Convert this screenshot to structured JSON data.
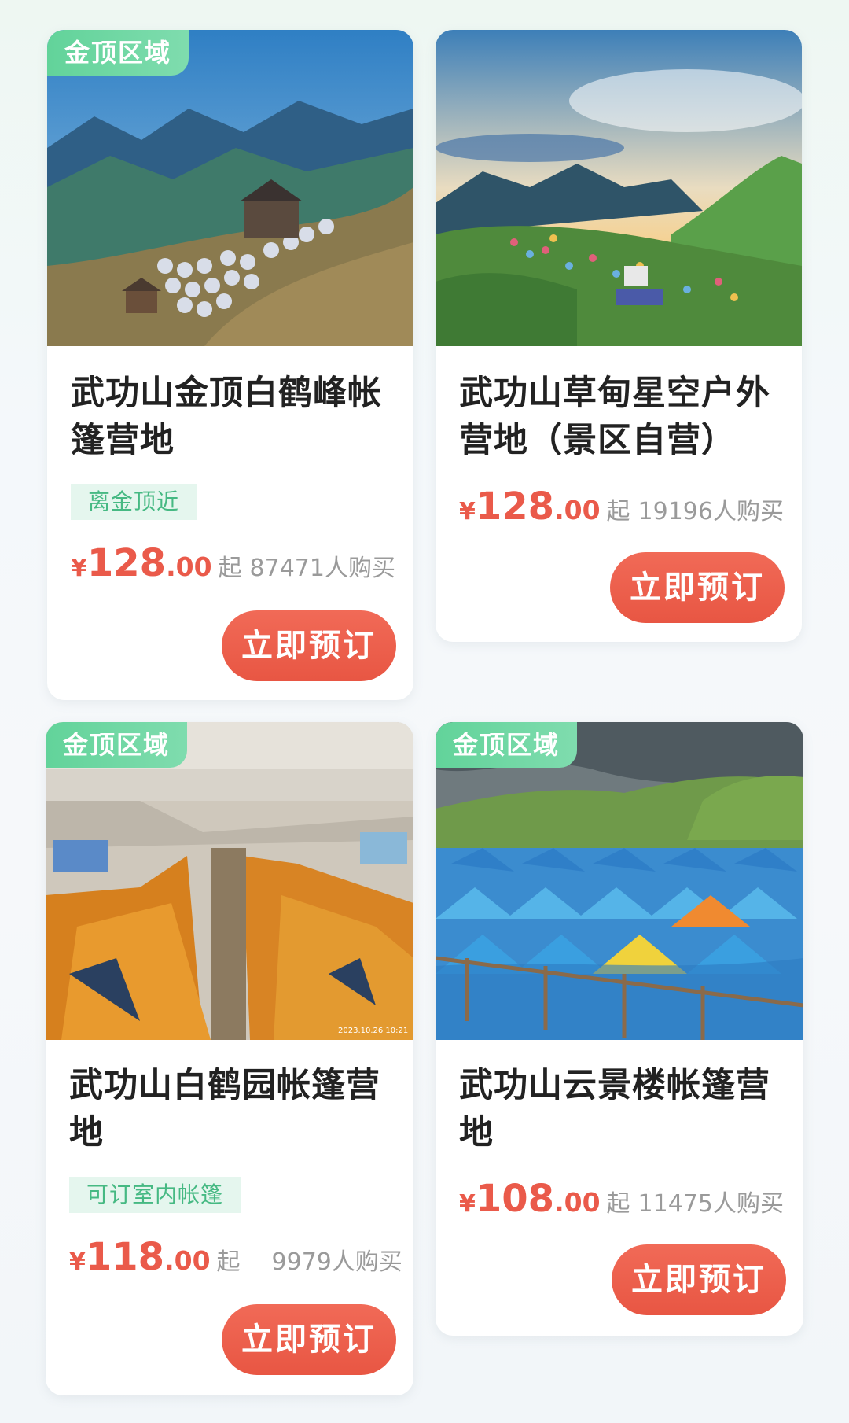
{
  "cards": [
    {
      "badge": "金顶区域",
      "title": "武功山金顶白鹤峰帐篷营地",
      "tag": "离金顶近",
      "currency": "¥",
      "price_int": "128",
      "price_dec": ".00",
      "from_label": "起",
      "sold": "87471人购买",
      "button": "立即预订"
    },
    {
      "badge": "",
      "title": "武功山草甸星空户外营地（景区自营）",
      "tag": "",
      "currency": "¥",
      "price_int": "128",
      "price_dec": ".00",
      "from_label": "起",
      "sold": "19196人购买",
      "button": "立即预订"
    },
    {
      "badge": "金顶区域",
      "title": "武功山白鹤园帐篷营地",
      "tag": "可订室内帐篷",
      "currency": "¥",
      "price_int": "118",
      "price_dec": ".00",
      "from_label": "起",
      "sold": "9979人购买",
      "button": "立即预订",
      "photo_timestamp": "2023.10.26 10:21"
    },
    {
      "badge": "金顶区域",
      "title": "武功山云景楼帐篷营地",
      "tag": "",
      "currency": "¥",
      "price_int": "108",
      "price_dec": ".00",
      "from_label": "起",
      "sold": "11475人购买",
      "button": "立即预订"
    }
  ],
  "colors": {
    "accent_red": "#ea5a4a",
    "badge_green": "#62d39a",
    "tag_bg": "#e5f6ee",
    "tag_text": "#46b983"
  }
}
